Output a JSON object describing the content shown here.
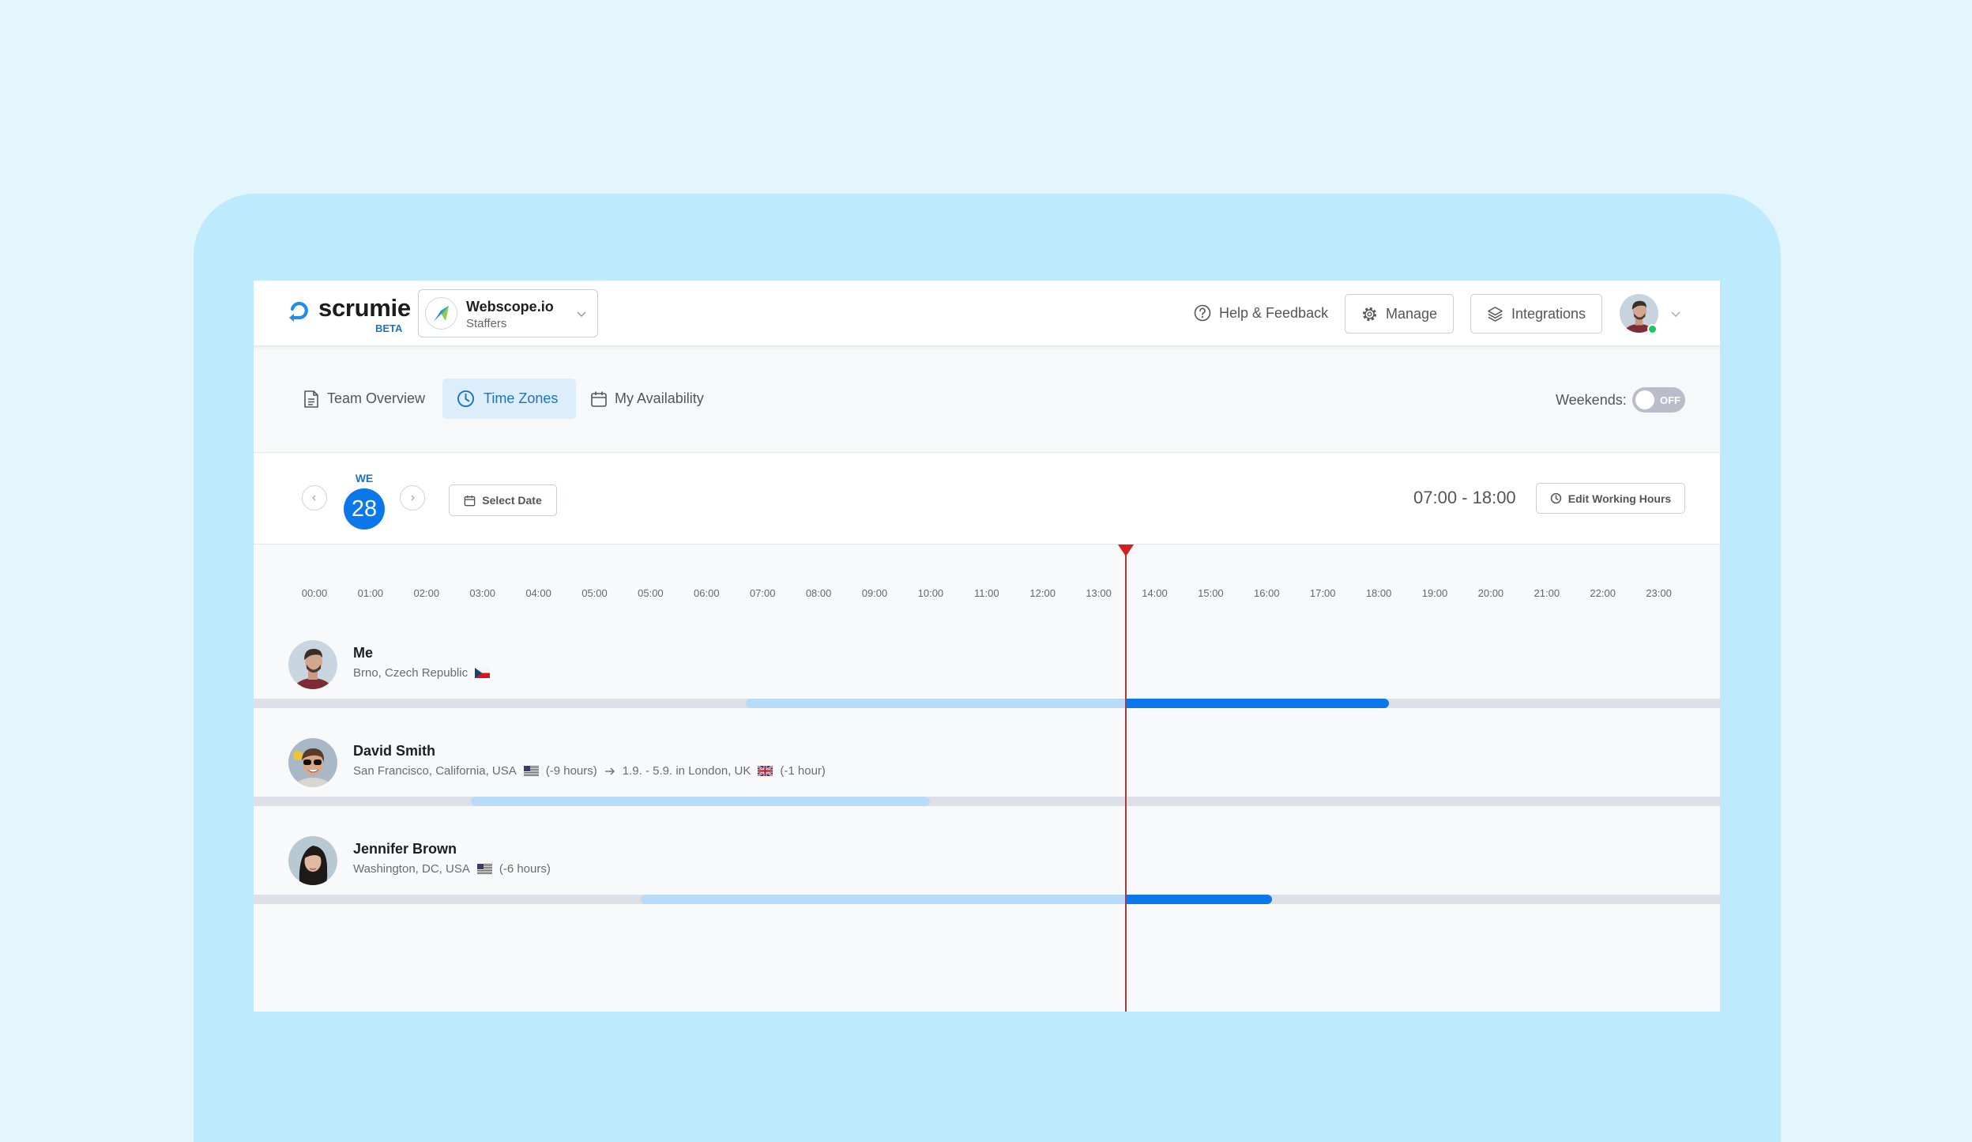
{
  "app": {
    "name": "scrumie",
    "badge": "BETA"
  },
  "org_selector": {
    "name": "Webscope.io",
    "team": "Staffers"
  },
  "header": {
    "help_label": "Help & Feedback",
    "manage_label": "Manage",
    "integrations_label": "Integrations"
  },
  "current_user": {
    "status": "online"
  },
  "tabs": [
    {
      "label": "Team Overview",
      "icon": "document-icon",
      "active": false
    },
    {
      "label": "Time Zones",
      "icon": "clock-icon",
      "active": true
    },
    {
      "label": "My Availability",
      "icon": "calendar-icon",
      "active": false
    }
  ],
  "weekends": {
    "label": "Weekends:",
    "state": "OFF"
  },
  "date_nav": {
    "weekday": "WE",
    "day": "28",
    "select_date_label": "Select Date"
  },
  "working_hours": {
    "range": "07:00 - 18:00",
    "edit_label": "Edit Working Hours"
  },
  "timeline": {
    "hour_labels": [
      "00:00",
      "01:00",
      "02:00",
      "03:00",
      "04:00",
      "05:00",
      "05:00",
      "06:00",
      "07:00",
      "08:00",
      "09:00",
      "10:00",
      "11:00",
      "12:00",
      "13:00",
      "14:00",
      "15:00",
      "16:00",
      "17:00",
      "18:00",
      "19:00",
      "20:00",
      "21:00",
      "22:00",
      "23:00"
    ],
    "current_time_hours": 13.5
  },
  "members": [
    {
      "name": "Me",
      "location": "Brno, Czech Republic",
      "flag": "cz",
      "availability_hours": {
        "start": 7,
        "end": 18
      }
    },
    {
      "name": "David Smith",
      "location": "San Francisco, California, USA",
      "flag": "us",
      "offset": "(-9 hours)",
      "travel": {
        "period": "1.9. - 5.9. in London, UK",
        "flag": "gb",
        "offset": "(-1 hour)"
      },
      "availability_hours": {
        "start": 2.3,
        "end": 10.15
      }
    },
    {
      "name": "Jennifer Brown",
      "location": "Washington, DC, USA",
      "flag": "us",
      "offset": "(-6 hours)",
      "availability_hours": {
        "start": 5.2,
        "end": 16
      }
    }
  ],
  "colors": {
    "accent": "#0a77ea",
    "elapsed": "#b8dbfa",
    "track": "#dde0e6",
    "now_marker": "#d71d1d",
    "online": "#21c45d",
    "active_tab_bg": "#dcedfc",
    "active_tab_text": "#1a73c8"
  }
}
